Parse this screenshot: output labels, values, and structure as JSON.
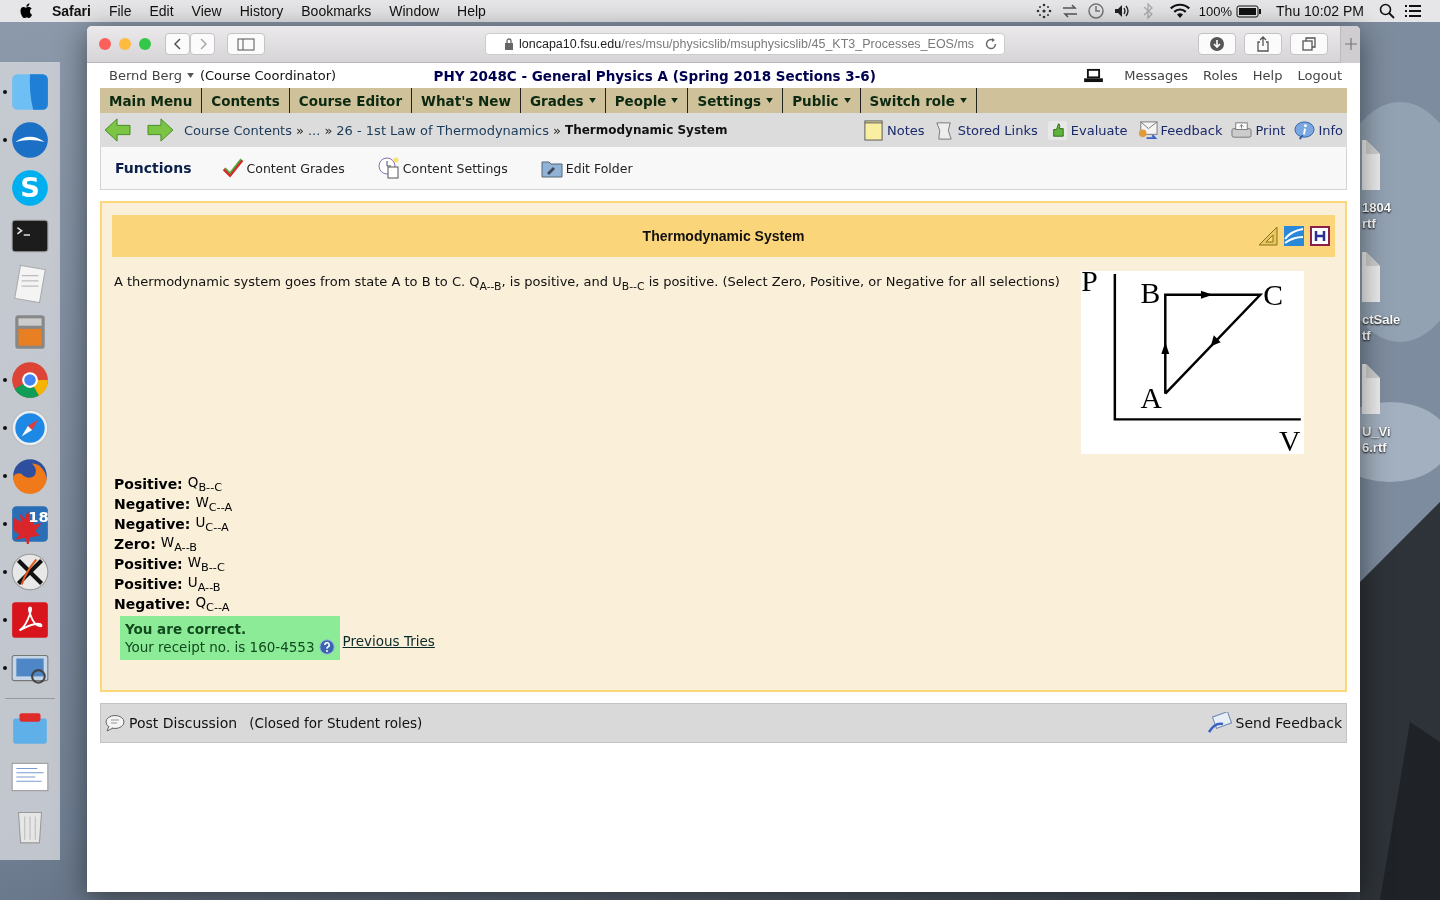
{
  "menubar": {
    "app": "Safari",
    "menus": [
      "File",
      "Edit",
      "View",
      "History",
      "Bookmarks",
      "Window",
      "Help"
    ],
    "battery": "100%",
    "clock": "Thu 10:02 PM"
  },
  "dock": [
    {
      "kind": "finder",
      "running": true
    },
    {
      "kind": "bird",
      "running": true
    },
    {
      "kind": "letter",
      "glyph": "S",
      "running": false
    },
    {
      "kind": "terminal",
      "running": false
    },
    {
      "kind": "paper",
      "running": false
    },
    {
      "kind": "calculator",
      "running": false
    },
    {
      "kind": "chrome",
      "running": true
    },
    {
      "kind": "compass",
      "running": true
    },
    {
      "kind": "fox",
      "running": true
    },
    {
      "kind": "leaf",
      "glyph": "18",
      "running": true
    },
    {
      "kind": "cross",
      "running": true
    },
    {
      "kind": "acrobat",
      "running": true
    },
    {
      "kind": "photos",
      "running": true
    },
    {
      "kind": "separator"
    },
    {
      "kind": "folder",
      "running": false
    },
    {
      "kind": "document",
      "running": false
    },
    {
      "kind": "trash",
      "running": false
    }
  ],
  "desktop_files": [
    {
      "lines": [
        "1804",
        "rtf"
      ]
    },
    {
      "lines": [
        "ctSale",
        "tf"
      ]
    },
    {
      "lines": [
        "U_Vi",
        "6.rtf"
      ]
    }
  ],
  "browser": {
    "url_host": "loncapa10.fsu.edu",
    "url_path": "/res/msu/physicslib/msuphysicslib/45_KT3_Processes_EOS/ms"
  },
  "user": {
    "name": "Bernd Berg",
    "role": "(Course Coordinator)"
  },
  "course_title": "PHY 2048C - General Physics A (Spring 2018 Sections 3-6)",
  "top_links": [
    "Messages",
    "Roles",
    "Help",
    "Logout"
  ],
  "nav": [
    {
      "label": "Main Menu",
      "has_menu": false
    },
    {
      "label": "Contents",
      "has_menu": false
    },
    {
      "label": "Course Editor",
      "has_menu": false
    },
    {
      "label": "What's New",
      "has_menu": false
    },
    {
      "label": "Grades",
      "has_menu": true
    },
    {
      "label": "People",
      "has_menu": true
    },
    {
      "label": "Settings",
      "has_menu": true
    },
    {
      "label": "Public",
      "has_menu": true
    },
    {
      "label": "Switch role",
      "has_menu": true
    }
  ],
  "breadcrumbs": {
    "separator": "»",
    "items": [
      {
        "label": "Course Contents",
        "current": false
      },
      {
        "label": "...",
        "current": false
      },
      {
        "label": "26 - 1st Law of Thermodynamics",
        "current": false
      },
      {
        "label": "Thermodynamic System",
        "current": true
      }
    ]
  },
  "tools": [
    {
      "kind": "notes",
      "label": "Notes"
    },
    {
      "kind": "links",
      "label": "Stored Links"
    },
    {
      "kind": "evaluate",
      "label": "Evaluate"
    },
    {
      "kind": "feedback",
      "label": "Feedback"
    },
    {
      "kind": "print",
      "label": "Print"
    },
    {
      "kind": "info",
      "label": "Info"
    }
  ],
  "functions": {
    "title": "Functions",
    "items": [
      {
        "kind": "grades",
        "label": "Content Grades"
      },
      {
        "kind": "settings",
        "label": "Content Settings"
      },
      {
        "kind": "folder",
        "label": "Edit Folder"
      }
    ]
  },
  "problem": {
    "title": "Thermodynamic System",
    "question": "A thermodynamic system goes from state A to B to C. Q$_{A--B}$, is positive, and U$_{B--C}$ is positive. (Select Zero, Positive, or Negative for all selections)",
    "diagram": {
      "axes": [
        "P",
        "V"
      ],
      "points": [
        "B",
        "C",
        "A"
      ]
    },
    "answers": [
      {
        "verdict": "Positive:",
        "quantity": "Q$_{B--C}$"
      },
      {
        "verdict": "Negative:",
        "quantity": "W$_{C--A}$"
      },
      {
        "verdict": "Negative:",
        "quantity": "U$_{C--A}$"
      },
      {
        "verdict": "Zero:",
        "quantity": "W$_{A--B}$"
      },
      {
        "verdict": "Positive:",
        "quantity": "W$_{B--C}$"
      },
      {
        "verdict": "Positive:",
        "quantity": "U$_{A--B}$"
      },
      {
        "verdict": "Negative:",
        "quantity": "Q$_{C--A}$"
      }
    ],
    "feedback": {
      "correct": true,
      "message": "You are correct.",
      "receipt": "Your receipt no. is 160-4553"
    },
    "previous_tries": "Previous Tries"
  },
  "discussion": {
    "post": "Post Discussion",
    "note": "(Closed for Student roles)",
    "send": "Send Feedback"
  }
}
